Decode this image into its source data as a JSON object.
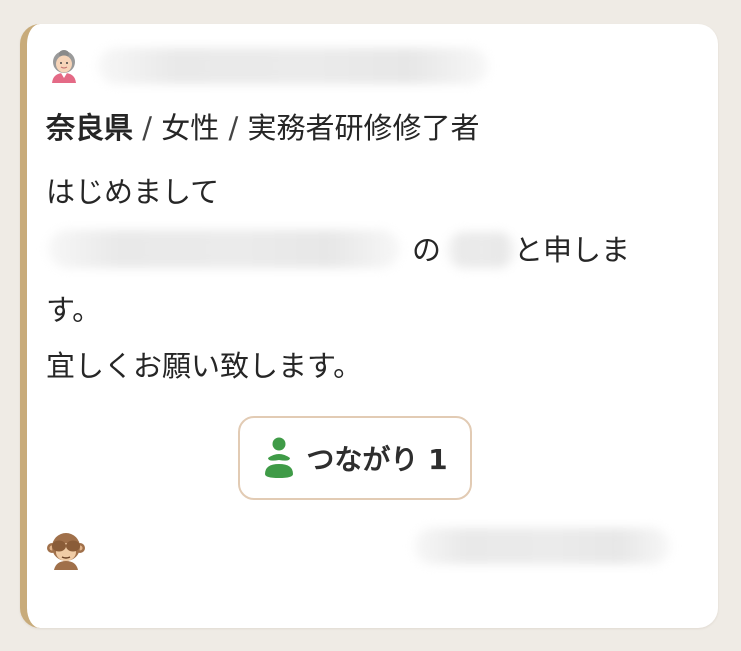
{
  "post": {
    "meta": {
      "prefecture": "奈良県",
      "separator": " / ",
      "gender": "女性",
      "qualification": "実務者研修修了者"
    },
    "body": {
      "line1": "はじめまして",
      "line2_a": "の",
      "line2_b": "と申しま",
      "line3": "す。",
      "line4": "宜しくお願い致します。"
    },
    "connect_button": {
      "label": "つながり 1"
    }
  },
  "icons": {
    "avatar": "elderly-woman-avatar-icon",
    "connect": "green-people-icon",
    "footer": "see-no-evil-monkey-icon"
  },
  "colors": {
    "page_background": "#efebe5",
    "card_border_accent": "#c8ab7a",
    "button_border": "#e2cbb4",
    "icon_green": "#3f9b47"
  }
}
